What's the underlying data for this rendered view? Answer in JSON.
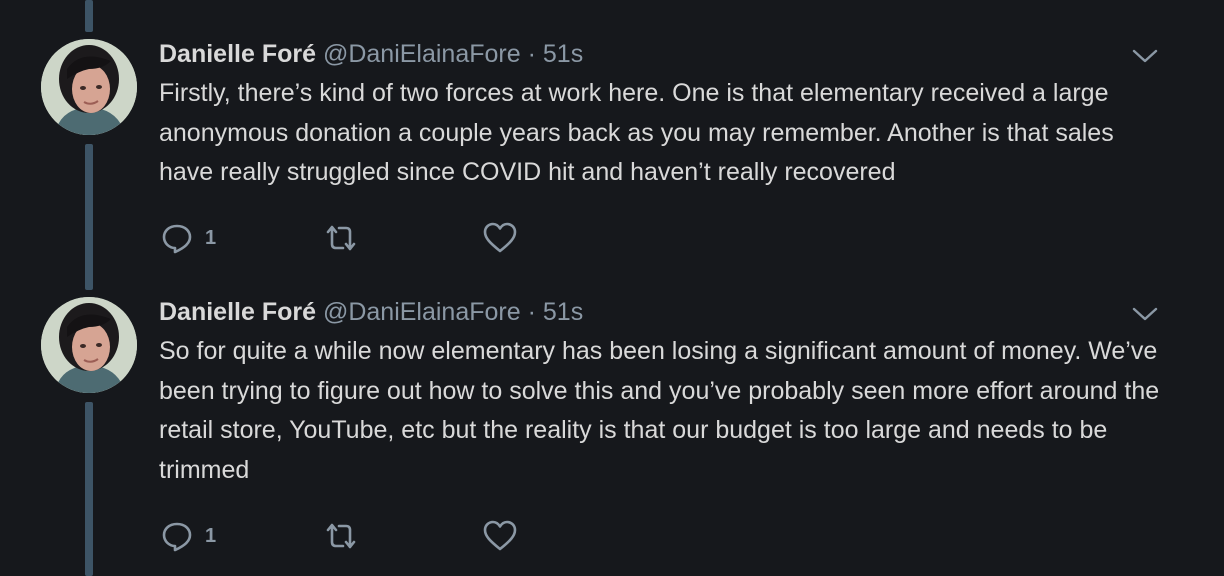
{
  "tweets": [
    {
      "author_name": "Danielle Foré",
      "handle": "@DaniElainaFore",
      "separator": "·",
      "time": "51s",
      "text": "Firstly, there’s kind of two forces at work here. One is that elementary received a large anonymous donation a couple years back as you may remember. Another is that sales have really struggled since COVID hit and haven’t really recovered",
      "reply_count": "1",
      "icons": [
        "reply-icon",
        "retweet-icon",
        "like-icon",
        "chevron-down-icon"
      ]
    },
    {
      "author_name": "Danielle Foré",
      "handle": "@DaniElainaFore",
      "separator": "·",
      "time": "51s",
      "text": "So for quite a while now elementary has been losing a significant amount of money. We’ve been trying to figure out how to solve this and you’ve probably seen more effort around the retail store, YouTube, etc but the reality is that our budget is too large and needs to be trimmed",
      "reply_count": "1",
      "icons": [
        "reply-icon",
        "retweet-icon",
        "like-icon",
        "chevron-down-icon"
      ]
    }
  ],
  "colors": {
    "background": "#16181c",
    "primary_text": "#d9d9d9",
    "secondary_text": "#8b98a5",
    "thread_line": "#3d5466"
  }
}
